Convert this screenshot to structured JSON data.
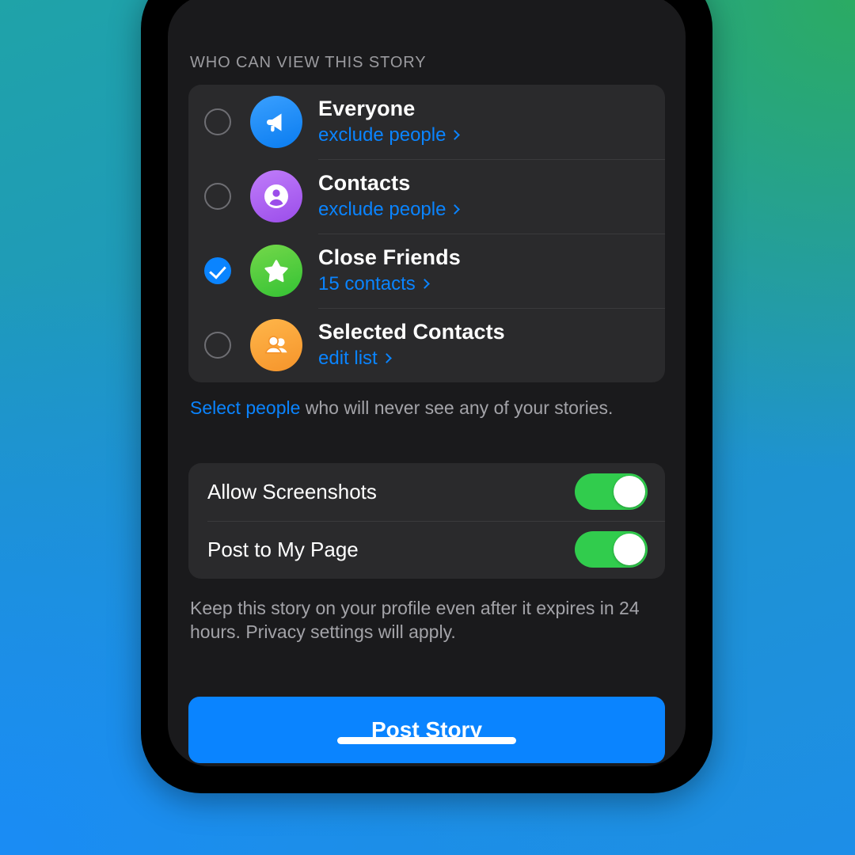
{
  "background": {
    "gradient_from": "#1fa3a8",
    "gradient_green": "#2bab63",
    "gradient_blue": "#1a8cf5"
  },
  "screen": {
    "bg_color": "#1a1a1c",
    "card_color": "#2a2a2c",
    "accent_blue": "#0a84ff",
    "toggle_green": "#31cc4d"
  },
  "audience": {
    "section_header": "WHO CAN VIEW THIS STORY",
    "options": [
      {
        "title": "Everyone",
        "sub": "exclude people",
        "icon": "megaphone-icon",
        "icon_color": "#3aa0ff",
        "selected": false
      },
      {
        "title": "Contacts",
        "sub": "exclude people",
        "icon": "person-circle-icon",
        "icon_color": "#9b4dea",
        "selected": false
      },
      {
        "title": "Close Friends",
        "sub": "15 contacts",
        "icon": "star-icon",
        "icon_color": "#34c234",
        "selected": true
      },
      {
        "title": "Selected Contacts",
        "sub": "edit list",
        "icon": "people-group-icon",
        "icon_color": "#f5942b",
        "selected": false
      }
    ],
    "note_link": "Select people",
    "note_rest": " who will never see any of your stories."
  },
  "settings": {
    "rows": [
      {
        "label": "Allow Screenshots",
        "enabled": true
      },
      {
        "label": "Post to My Page",
        "enabled": true
      }
    ],
    "footer_note": "Keep this story on your profile even after it expires in 24 hours. Privacy settings will apply."
  },
  "actions": {
    "post_story": "Post Story"
  }
}
